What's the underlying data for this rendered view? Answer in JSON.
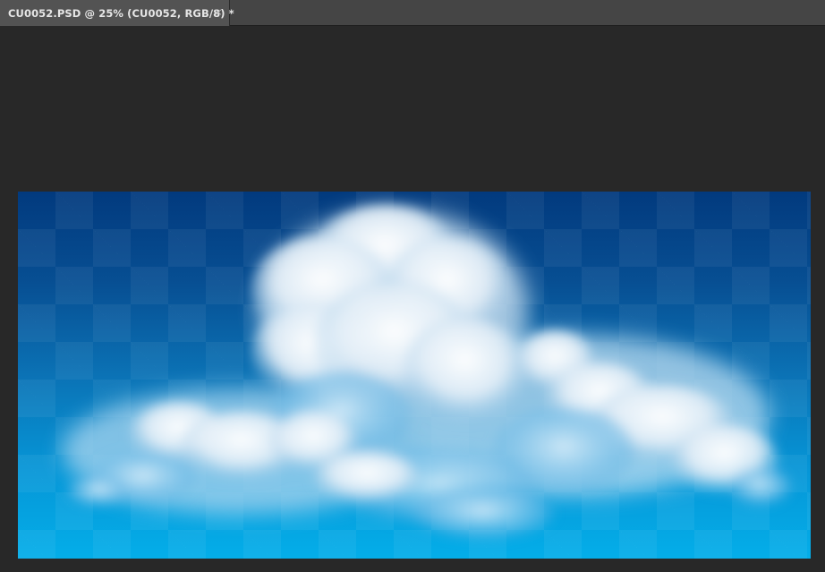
{
  "document_tab": {
    "title": "CU0052.PSD @ 25% (CU0052, RGB/8) *",
    "close_glyph": "×"
  },
  "canvas": {
    "artwork": "cumulus-clouds-on-blue-sky",
    "colors": {
      "sky_top": "#023a7e",
      "sky_bottom": "#04aee9",
      "pasteboard": "#282828"
    }
  }
}
